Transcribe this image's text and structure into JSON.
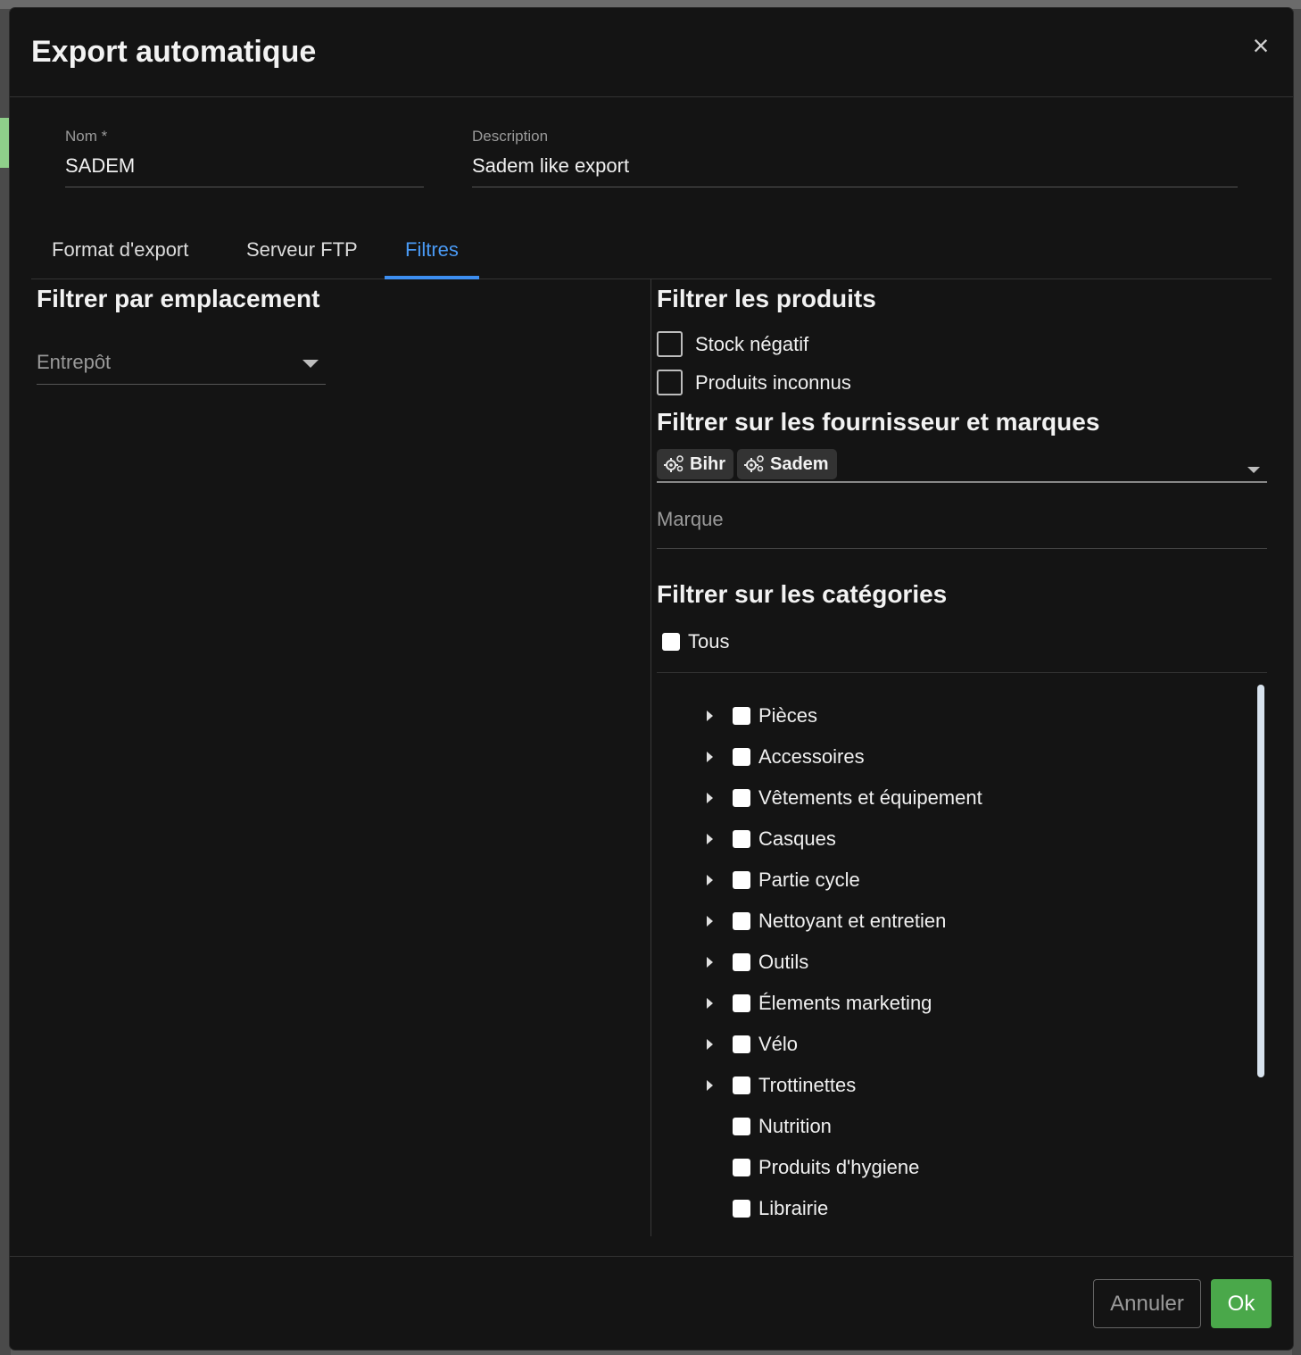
{
  "modal": {
    "title": "Export automatique",
    "close_label": "×"
  },
  "fields": {
    "name": {
      "label": "Nom *",
      "value": "SADEM"
    },
    "description": {
      "label": "Description",
      "value": "Sadem like export"
    }
  },
  "tabs": [
    {
      "label": "Format d'export",
      "active": false
    },
    {
      "label": "Serveur FTP",
      "active": false
    },
    {
      "label": "Filtres",
      "active": true
    }
  ],
  "location_filter": {
    "title": "Filtrer par emplacement",
    "warehouse_placeholder": "Entrepôt"
  },
  "product_filter": {
    "title": "Filtrer les produits",
    "options": [
      {
        "label": "Stock négatif",
        "checked": false
      },
      {
        "label": "Produits inconnus",
        "checked": false
      }
    ]
  },
  "supplier_filter": {
    "title": "Filtrer sur les fournisseur et marques",
    "chips": [
      "Bihr",
      "Sadem"
    ],
    "brand_placeholder": "Marque"
  },
  "category_filter": {
    "title": "Filtrer sur les catégories",
    "all_label": "Tous",
    "items": [
      {
        "label": "Pièces",
        "expandable": true
      },
      {
        "label": "Accessoires",
        "expandable": true
      },
      {
        "label": "Vêtements et équipement",
        "expandable": true
      },
      {
        "label": "Casques",
        "expandable": true
      },
      {
        "label": "Partie cycle",
        "expandable": true
      },
      {
        "label": "Nettoyant et entretien",
        "expandable": true
      },
      {
        "label": "Outils",
        "expandable": true
      },
      {
        "label": "Élements marketing",
        "expandable": true
      },
      {
        "label": "Vélo",
        "expandable": true
      },
      {
        "label": "Trottinettes",
        "expandable": true
      },
      {
        "label": "Nutrition",
        "expandable": false
      },
      {
        "label": "Produits d'hygiene",
        "expandable": false
      },
      {
        "label": "Librairie",
        "expandable": false
      }
    ]
  },
  "footer": {
    "cancel_label": "Annuler",
    "ok_label": "Ok"
  },
  "colors": {
    "accent": "#3d8ef0",
    "ok": "#4aa84a",
    "background": "#141414"
  }
}
